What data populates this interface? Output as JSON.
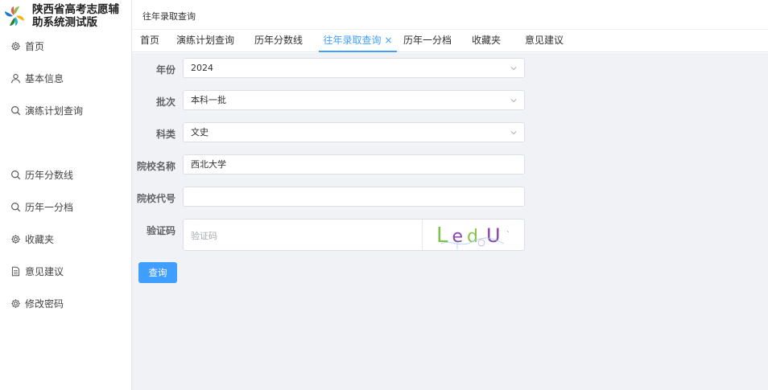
{
  "app": {
    "title_line1": "陕西省高考志愿辅",
    "title_line2": "助系统测试版"
  },
  "sidebar": {
    "items": [
      {
        "label": "首页",
        "icon": "gear-icon"
      },
      {
        "label": "基本信息",
        "icon": "user-icon"
      },
      {
        "label": "演练计划查询",
        "icon": "search-icon"
      },
      {
        "label": "历年分数线",
        "icon": "search-icon"
      },
      {
        "label": "历年一分档",
        "icon": "search-icon"
      },
      {
        "label": "收藏夹",
        "icon": "gear-icon"
      },
      {
        "label": "意见建议",
        "icon": "document-icon"
      },
      {
        "label": "修改密码",
        "icon": "gear-icon"
      }
    ]
  },
  "header": {
    "breadcrumb": "往年录取查询"
  },
  "tabs": [
    {
      "label": "首页"
    },
    {
      "label": "演练计划查询"
    },
    {
      "label": "历年分数线"
    },
    {
      "label": "往年录取查询",
      "active": true,
      "closable": true,
      "close_glyph": "×"
    },
    {
      "label": "历年一分档"
    },
    {
      "label": "收藏夹"
    },
    {
      "label": "意见建议"
    }
  ],
  "form": {
    "year_label": "年份",
    "year_value": "2024",
    "batch_label": "批次",
    "batch_value": "本科一批",
    "subject_label": "科类",
    "subject_value": "文史",
    "school_name_label": "院校名称",
    "school_name_value": "西北大学",
    "school_code_label": "院校代号",
    "school_code_value": "",
    "captcha_label": "验证码",
    "captcha_placeholder": "验证码",
    "captcha_text": "LedU",
    "submit_label": "查询"
  },
  "colors": {
    "accent": "#409eff",
    "background": "#f0f2f5"
  }
}
